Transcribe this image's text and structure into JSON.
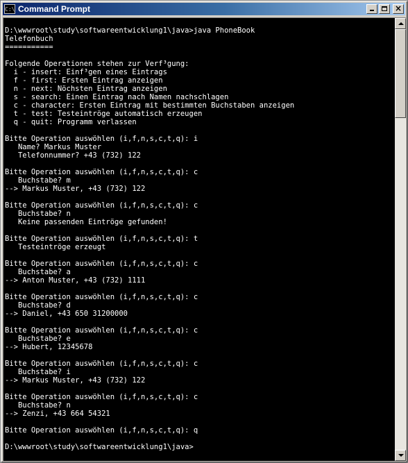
{
  "window": {
    "title": "Command Prompt",
    "icon_label": "C:\\",
    "icon": "cmd-icon",
    "buttons": [
      "minimize-icon",
      "maximize-icon",
      "close-icon"
    ],
    "close_glyph": "×"
  },
  "console": {
    "lines": [
      "D:\\wwwroot\\study\\softwareentwicklung1\\java>java PhoneBook",
      "Telefonbuch",
      "===========",
      "",
      "Folgende Operationen stehen zur Verf³gung:",
      "  i - insert: Einf³gen eines Eintrags",
      "  f - first: Ersten Eintrag anzeigen",
      "  n - next: Nöchsten Eintrag anzeigen",
      "  s - search: Einen Eintrag nach Namen nachschlagen",
      "  c - character: Ersten Eintrag mit bestimmten Buchstaben anzeigen",
      "  t - test: Testeintröge automatisch erzeugen",
      "  q - quit: Programm verlassen",
      "",
      "Bitte Operation auswöhlen (i,f,n,s,c,t,q): i",
      "   Name? Markus Muster",
      "   Telefonnummer? +43 (732) 122",
      "",
      "Bitte Operation auswöhlen (i,f,n,s,c,t,q): c",
      "   Buchstabe? m",
      "--> Markus Muster, +43 (732) 122",
      "",
      "Bitte Operation auswöhlen (i,f,n,s,c,t,q): c",
      "   Buchstabe? n",
      "   Keine passenden Eintröge gefunden!",
      "",
      "Bitte Operation auswöhlen (i,f,n,s,c,t,q): t",
      "   Testeintröge erzeugt",
      "",
      "Bitte Operation auswöhlen (i,f,n,s,c,t,q): c",
      "   Buchstabe? a",
      "--> Anton Muster, +43 (732) 1111",
      "",
      "Bitte Operation auswöhlen (i,f,n,s,c,t,q): c",
      "   Buchstabe? d",
      "--> Daniel, +43 650 31200000",
      "",
      "Bitte Operation auswöhlen (i,f,n,s,c,t,q): c",
      "   Buchstabe? e",
      "--> Hubert, 12345678",
      "",
      "Bitte Operation auswöhlen (i,f,n,s,c,t,q): c",
      "   Buchstabe? i",
      "--> Markus Muster, +43 (732) 122",
      "",
      "Bitte Operation auswöhlen (i,f,n,s,c,t,q): c",
      "   Buchstabe? n",
      "--> Zenzi, +43 664 54321",
      "",
      "Bitte Operation auswöhlen (i,f,n,s,c,t,q): q",
      "",
      "D:\\wwwroot\\study\\softwareentwicklung1\\java>"
    ]
  },
  "colors": {
    "title_bar": "#0a246a",
    "console_bg": "#000000",
    "console_fg": "#ffffff"
  }
}
